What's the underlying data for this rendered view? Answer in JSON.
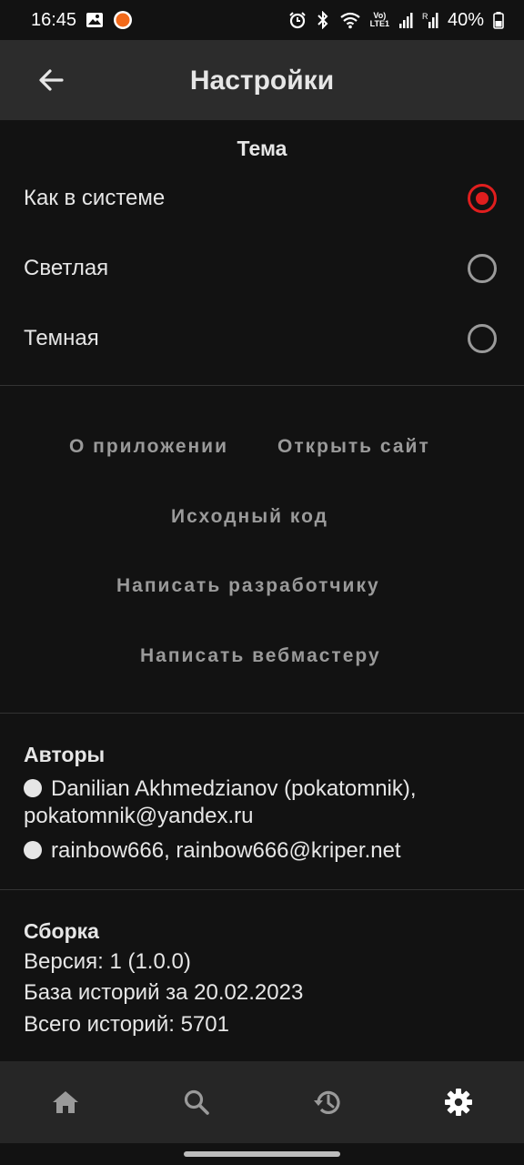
{
  "status_bar": {
    "time": "16:45",
    "battery": "40%",
    "icons": [
      "gallery-icon",
      "app-notification-icon",
      "alarm-icon",
      "bluetooth-icon",
      "wifi-icon",
      "volte-icon",
      "signal-icon",
      "signal-r-icon",
      "battery-icon"
    ],
    "volte_label": "Vo)\nLTE1"
  },
  "app_bar": {
    "title": "Настройки",
    "back_icon": "arrow-left-icon"
  },
  "theme": {
    "title": "Тема",
    "options": [
      {
        "label": "Как в системе",
        "selected": true
      },
      {
        "label": "Светлая",
        "selected": false
      },
      {
        "label": "Темная",
        "selected": false
      }
    ],
    "accent_color": "#e01e1e"
  },
  "links": {
    "about": "О приложении",
    "open_site": "Открыть сайт",
    "source_code": "Исходный код",
    "write_developer": "Написать разработчику",
    "write_webmaster": "Написать вебмастеру"
  },
  "authors": {
    "title": "Авторы",
    "entries": [
      {
        "line1": "Danilian Akhmedzianov (pokatomnik),",
        "line2": "pokatomnik@yandex.ru"
      },
      {
        "line1": "rainbow666, rainbow666@kriper.net"
      }
    ]
  },
  "build": {
    "title": "Сборка",
    "version": "Версия: 1 (1.0.0)",
    "stories_base": "База историй за 20.02.2023",
    "stories_total": "Всего историй: 5701"
  },
  "bottom_nav": {
    "items": [
      "home-icon",
      "search-icon",
      "history-icon",
      "settings-icon"
    ],
    "active": "settings-icon"
  }
}
